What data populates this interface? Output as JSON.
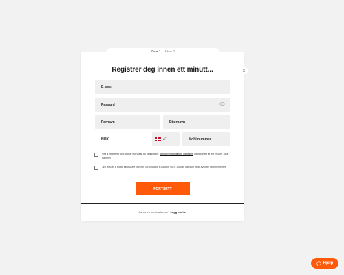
{
  "steps": {
    "step1": "Steg 1",
    "step2": "Steg 2"
  },
  "dialog": {
    "title": "Registrer deg innen ett minutt...",
    "close_glyph": "×"
  },
  "fields": {
    "email": "E-post",
    "password": "Passord",
    "first_name": "Fornavn",
    "last_name": "Etternavn",
    "country": "NOK",
    "country_code": "47",
    "mobile": "Mobilnummer"
  },
  "consents": {
    "terms_prefix": "Ved å registrere deg godtar jeg vilkår og betingelser,",
    "terms_link": "personvernerklæring og regler,",
    "terms_suffix": "og bekrefter at jeg er over 18 år gammel.",
    "marketing": "Jeg ønsker å motta eksklusive bonuser og tilbud på e-post og SMS. Du kan når som helst avslutte abonnementet."
  },
  "submit_label": "FORTSETT",
  "footer": {
    "prompt": "Har du en konto allerede?",
    "login_link": "Logg inn her"
  },
  "help": {
    "label": "Hjelp",
    "icon": "chat-bubble-icon"
  },
  "colors": {
    "accent": "#ff5a0a",
    "field_bg": "#efefef",
    "page_bg": "#f2f2f2"
  }
}
